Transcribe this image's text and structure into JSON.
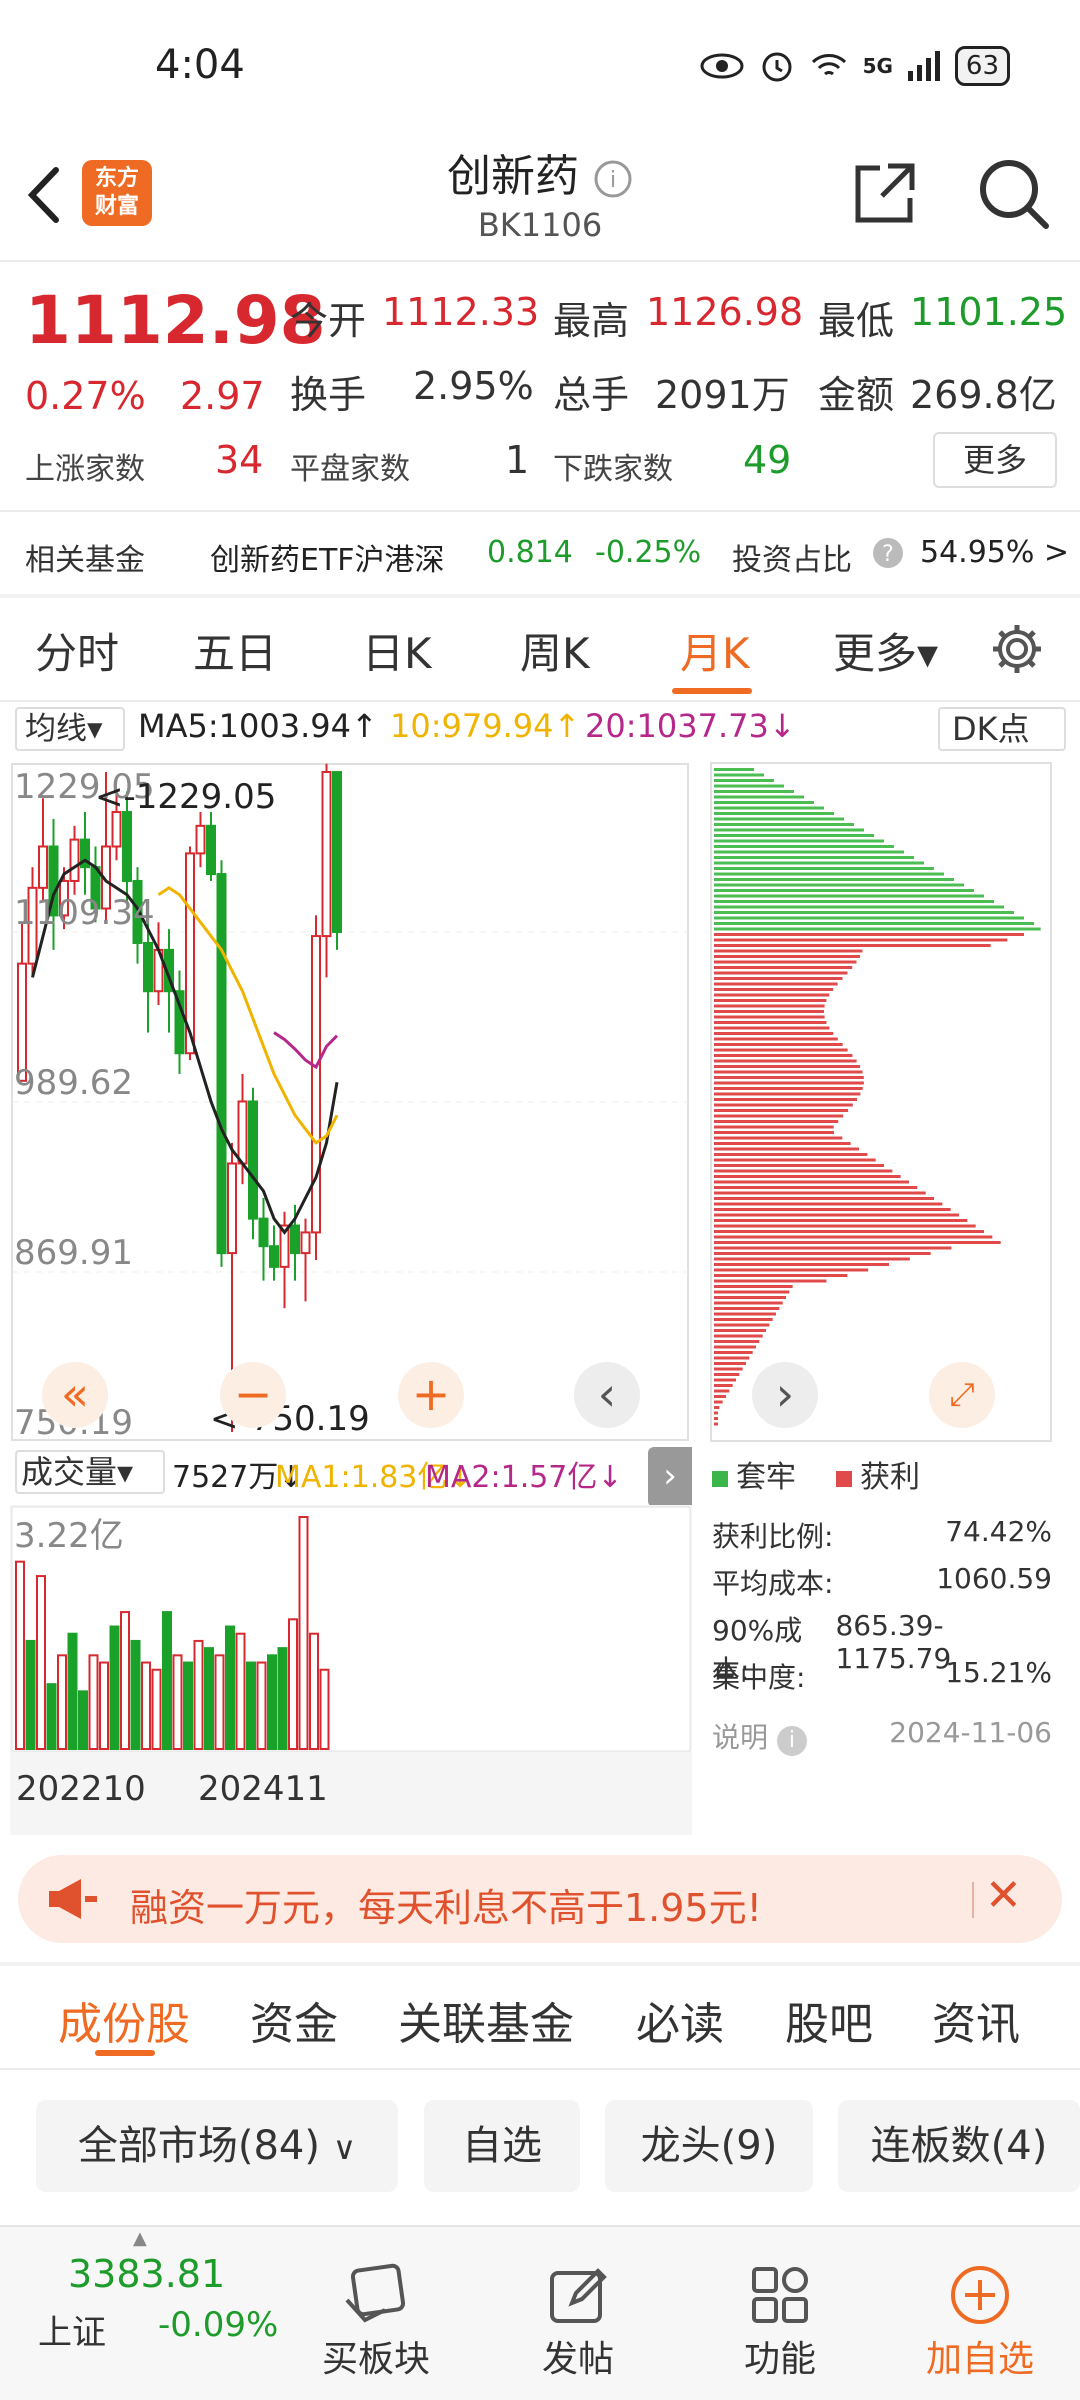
{
  "status_bar": {
    "time": "4:04",
    "network": "5G",
    "battery": "63"
  },
  "header": {
    "logo_line1": "东方",
    "logo_line2": "财富",
    "title": "创新药",
    "code": "BK1106"
  },
  "quote": {
    "price": "1112.98",
    "change_pct": "0.27%",
    "change": "2.97",
    "open_label": "今开",
    "open": "1112.33",
    "high_label": "最高",
    "high": "1126.98",
    "low_label": "最低",
    "low": "1101.25",
    "turnover_label": "换手",
    "turnover": "2.95%",
    "volume_label": "总手",
    "volume": "2091万",
    "amount_label": "金额",
    "amount": "269.8亿",
    "up_label": "上涨家数",
    "up": "34",
    "flat_label": "平盘家数",
    "flat": "1",
    "down_label": "下跌家数",
    "down": "49",
    "more_label": "更多"
  },
  "fund": {
    "label": "相关基金",
    "name": "创新药ETF沪港深",
    "price": "0.814",
    "pct": "-0.25%",
    "ratio_label": "投资占比",
    "ratio": "54.95% >"
  },
  "tabs": [
    "分时",
    "五日",
    "日K",
    "周K",
    "月K",
    "更多▾"
  ],
  "active_tab": "月K",
  "ma": {
    "selector": "均线▾",
    "ma5": "MA5:1003.94↑",
    "ma10": "10:979.94↑",
    "ma20": "20:1037.73↓",
    "dk": "DK点"
  },
  "chart_data": {
    "type": "candlestick",
    "y_labels": [
      "1229.05",
      "1109.34",
      "989.62",
      "869.91",
      "750.19"
    ],
    "max_note": "<-1229.05",
    "min_note": "<-750.19",
    "ylim": [
      750.19,
      1229.05
    ],
    "candles": [
      [
        1005,
        1090,
        1005,
        1120
      ],
      [
        1090,
        1145,
        1080,
        1160
      ],
      [
        1145,
        1175,
        1135,
        1210
      ],
      [
        1175,
        1125,
        1100,
        1195
      ],
      [
        1125,
        1150,
        1115,
        1160
      ],
      [
        1150,
        1180,
        1140,
        1190
      ],
      [
        1180,
        1160,
        1140,
        1200
      ],
      [
        1160,
        1130,
        1120,
        1175
      ],
      [
        1130,
        1175,
        1120,
        1229.05
      ],
      [
        1175,
        1200,
        1165,
        1215
      ],
      [
        1200,
        1150,
        1135,
        1215
      ],
      [
        1150,
        1105,
        1090,
        1160
      ],
      [
        1105,
        1070,
        1040,
        1120
      ],
      [
        1070,
        1100,
        1060,
        1120
      ],
      [
        1100,
        1070,
        1040,
        1115
      ],
      [
        1070,
        1025,
        1010,
        1085
      ],
      [
        1025,
        1170,
        1020,
        1175
      ],
      [
        1170,
        1190,
        1160,
        1200
      ],
      [
        1190,
        1155,
        1150,
        1200
      ],
      [
        1155,
        880,
        870,
        1165
      ],
      [
        880,
        945,
        750.19,
        960
      ],
      [
        945,
        990,
        930,
        1010
      ],
      [
        990,
        905,
        890,
        1000
      ],
      [
        905,
        885,
        860,
        920
      ],
      [
        885,
        870,
        860,
        900
      ],
      [
        870,
        900,
        840,
        910
      ],
      [
        900,
        880,
        860,
        915
      ],
      [
        880,
        895,
        845,
        905
      ],
      [
        895,
        1110,
        875,
        1125
      ],
      [
        1110,
        1229.05,
        1080,
        1235
      ],
      [
        1229,
        1112.98,
        1100,
        1130
      ]
    ],
    "ma5": [
      1080,
      1110,
      1140,
      1155,
      1160,
      1165,
      1160,
      1150,
      1145,
      1140,
      1130,
      1115,
      1100,
      1080,
      1060,
      1040,
      1015,
      990,
      970,
      955,
      945,
      935,
      925,
      905,
      895,
      905,
      920,
      935,
      960,
      1003.94
    ],
    "ma10": [
      1140,
      1145,
      1140,
      1130,
      1120,
      1110,
      1100,
      1085,
      1070,
      1050,
      1030,
      1010,
      995,
      980,
      970,
      960,
      965,
      979.94
    ],
    "ma20": [
      1040,
      1035,
      1028,
      1020,
      1015,
      1030,
      1037.73
    ],
    "chips_profit": [
      74.42
    ],
    "profit_ratio": "74.42%"
  },
  "chips": {
    "legend_trap": "套牢",
    "legend_profit": "获利",
    "profit_ratio_label": "获利比例:",
    "profit_ratio": "74.42%",
    "avg_cost_label": "平均成本:",
    "avg_cost": "1060.59",
    "cost90_label": "90%成本:",
    "cost90": "865.39-1175.79",
    "concentration_label": "集中度:",
    "concentration": "15.21%",
    "note_label": "说明",
    "date": "2024-11-06"
  },
  "volume": {
    "selector": "成交量▾",
    "v": "7527万↓",
    "ma1": "MA1:1.83亿↓",
    "ma2": "MA2:1.57亿↓",
    "max_label": "3.22亿",
    "x_start": "202210",
    "x_end": "202411",
    "bars": [
      2.6,
      1.5,
      2.4,
      0.9,
      1.3,
      1.6,
      0.8,
      1.3,
      1.2,
      1.7,
      1.9,
      1.5,
      1.2,
      1.1,
      1.9,
      1.3,
      1.2,
      1.5,
      1.4,
      1.3,
      1.7,
      1.6,
      1.2,
      1.2,
      1.3,
      1.4,
      1.8,
      3.22,
      1.6,
      1.1
    ],
    "colors": [
      "r",
      "g",
      "r",
      "g",
      "r",
      "g",
      "g",
      "r",
      "r",
      "g",
      "r",
      "g",
      "r",
      "r",
      "g",
      "r",
      "g",
      "r",
      "g",
      "r",
      "g",
      "r",
      "g",
      "r",
      "g",
      "g",
      "r",
      "r",
      "r",
      "r"
    ]
  },
  "promo": {
    "text": "融资一万元，每天利息不高于1.95元!"
  },
  "bottom_tabs": [
    "成份股",
    "资金",
    "关联基金",
    "必读",
    "股吧",
    "资讯"
  ],
  "filters": [
    "全部市场(84)",
    "自选",
    "龙头(9)",
    "连板数(4)"
  ],
  "bottom_nav": {
    "index_value": "3383.81",
    "index_name": "上证",
    "index_pct": "-0.09%",
    "buy_sector": "买板块",
    "post": "发帖",
    "func": "功能",
    "add": "加自选"
  },
  "colors": {
    "accent": "#ef6a22",
    "up": "#d7282f",
    "down": "#1e9c2b",
    "ma5": "#222222",
    "ma10": "#f0b400",
    "ma20": "#b5288a"
  }
}
